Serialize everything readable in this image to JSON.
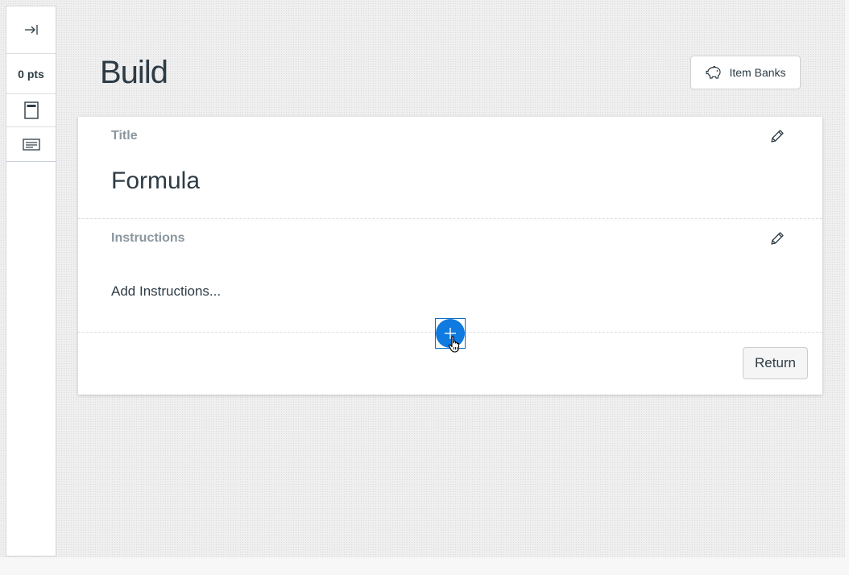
{
  "rail": {
    "points": "0 pts"
  },
  "header": {
    "title": "Build",
    "item_banks_label": "Item Banks"
  },
  "card": {
    "title_label": "Title",
    "title_value": "Formula",
    "instructions_label": "Instructions",
    "instructions_placeholder": "Add Instructions...",
    "return_label": "Return"
  },
  "icons": {
    "expand": "arrow-to-right-icon",
    "question_1": "question-page-icon",
    "question_2": "text-block-icon",
    "item_banks": "piggy-bank-icon",
    "edit": "pencil-icon",
    "add": "plus-icon",
    "cursor": "hand-pointer-icon"
  },
  "colors": {
    "accent": "#0f7ae0",
    "text": "#2d3b45",
    "label": "#8b969e"
  }
}
